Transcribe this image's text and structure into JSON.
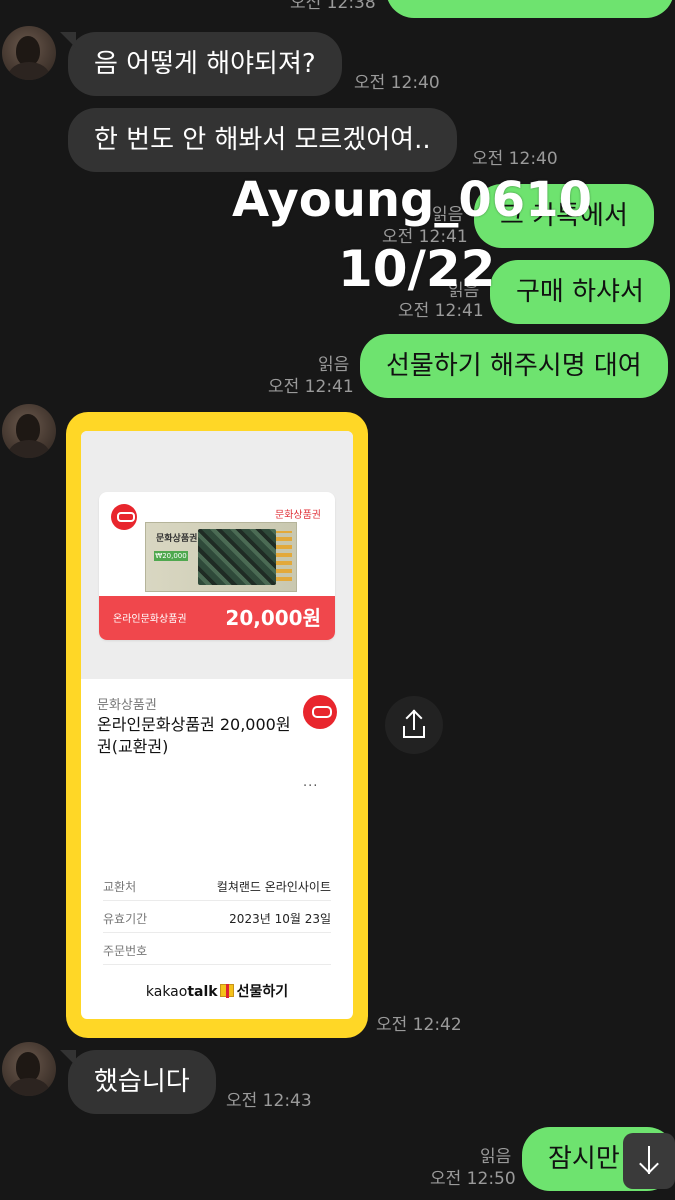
{
  "top_partial": {
    "time": "오전 12:38"
  },
  "messages": {
    "in1": {
      "text": "음 어떻게 해야되져?",
      "time": "오전 12:40"
    },
    "in2": {
      "text": "한 번도 안 해봐서 모르겠어여..",
      "time": "오전 12:40"
    },
    "out1": {
      "text": "그 카톡에서",
      "read": "읽음",
      "time": "오전 12:41"
    },
    "out2": {
      "text": "구매 하샤서",
      "read": "읽음",
      "time": "오전 12:41"
    },
    "out3": {
      "text": "선물하기 해주시명 대여",
      "read": "읽음",
      "time": "오전 12:41"
    },
    "in3": {
      "text": "했습니다",
      "time": "오전 12:43"
    },
    "out4": {
      "text": "잠시만",
      "read": "읽음",
      "time": "오전 12:50"
    }
  },
  "overlay": {
    "line1": "Ayoung_0610",
    "line2": "10/22"
  },
  "gift": {
    "ticket_brand": "문화상품권",
    "ticket_art_title": "문화상품권",
    "ticket_art_price": "₩20,000",
    "ticket_label": "온라인문화상품권",
    "ticket_amount": "20,000원",
    "category": "문화상품권",
    "title": "온라인문화상품권 20,000원권(교환권)",
    "more": "...",
    "rows": [
      {
        "k": "교환처",
        "v": "컬쳐랜드 온라인사이트"
      },
      {
        "k": "유효기간",
        "v": "2023년 10월 23일"
      },
      {
        "k": "주문번호",
        "v": ""
      }
    ],
    "footer_kakao": "kakao",
    "footer_talk": "talk",
    "footer_gift": "선물하기",
    "time": "오전 12:42"
  },
  "colors": {
    "background": "#171717",
    "incoming": "#333333",
    "outgoing": "#6ee36f",
    "gift_frame": "#ffd726",
    "ticket_red": "#f0474c"
  },
  "icons": {
    "share": "share-icon",
    "scroll": "arrow-down-icon"
  }
}
